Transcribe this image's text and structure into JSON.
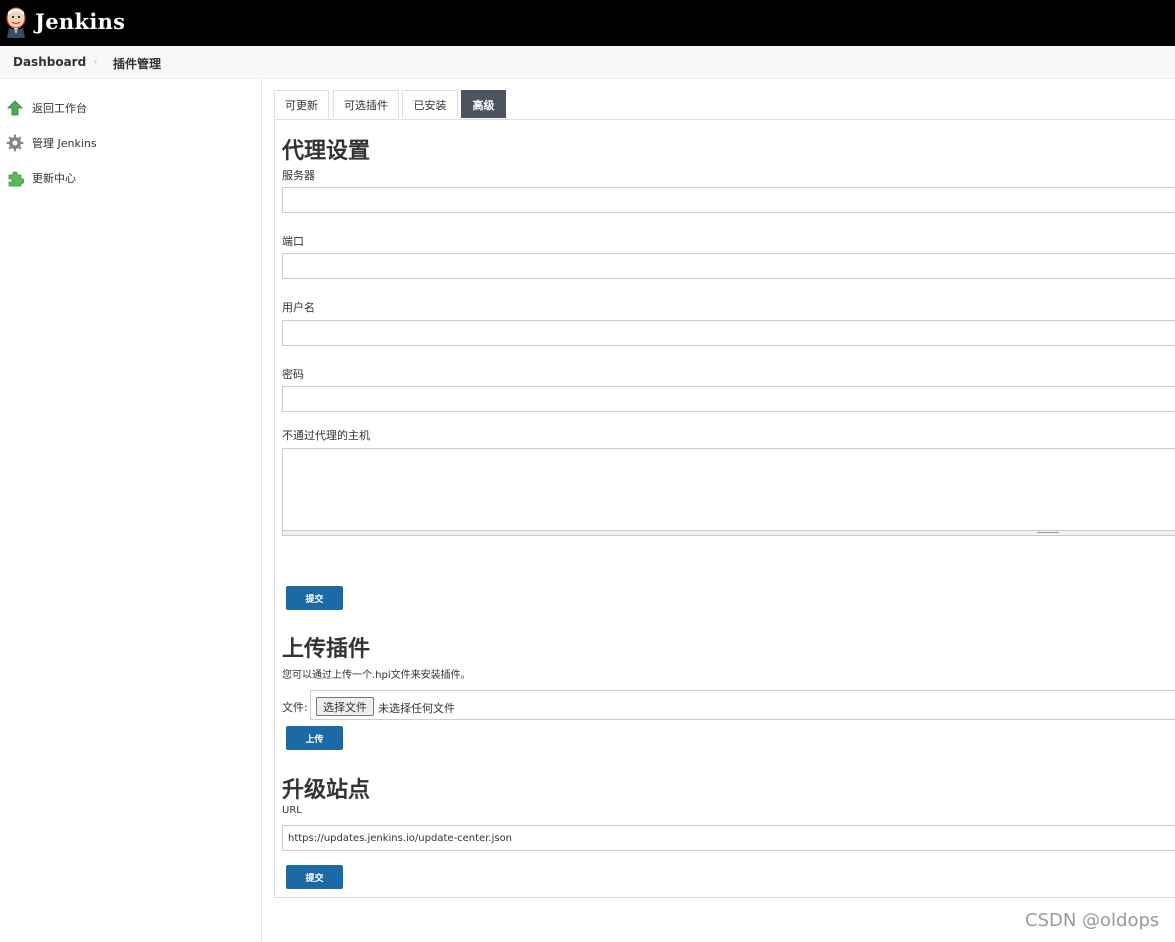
{
  "header": {
    "brand": "Jenkins",
    "logo_icon": "jenkins-butler-logo"
  },
  "breadcrumb": {
    "items": [
      "Dashboard",
      "插件管理"
    ],
    "separator": "›"
  },
  "sidebar": {
    "items": [
      {
        "label": "返回工作台",
        "icon": "up-arrow-icon"
      },
      {
        "label": "管理 Jenkins",
        "icon": "gear-icon"
      },
      {
        "label": "更新中心",
        "icon": "puzzle-icon"
      }
    ]
  },
  "tabs": [
    {
      "label": "可更新",
      "active": false
    },
    {
      "label": "可选插件",
      "active": false
    },
    {
      "label": "已安装",
      "active": false
    },
    {
      "label": "高级",
      "active": true
    }
  ],
  "proxy": {
    "title": "代理设置",
    "server_label": "服务器",
    "server_value": "",
    "port_label": "端口",
    "port_value": "",
    "username_label": "用户名",
    "username_value": "",
    "password_label": "密码",
    "password_value": "",
    "no_proxy_label": "不通过代理的主机",
    "no_proxy_value": "",
    "submit_label": "提交"
  },
  "upload": {
    "title": "上传插件",
    "description": "您可以通过上传一个.hpi文件来安装插件。",
    "file_label": "文件:",
    "choose_button": "选择文件",
    "no_file_text": "未选择任何文件",
    "upload_label": "上传"
  },
  "update_site": {
    "title": "升级站点",
    "url_label": "URL",
    "url_value": "https://updates.jenkins.io/update-center.json",
    "submit_label": "提交"
  },
  "watermark": "CSDN @oldops",
  "colors": {
    "topbar": "#000000",
    "primary_button": "#1b6aa5",
    "active_tab": "#4d545d"
  }
}
